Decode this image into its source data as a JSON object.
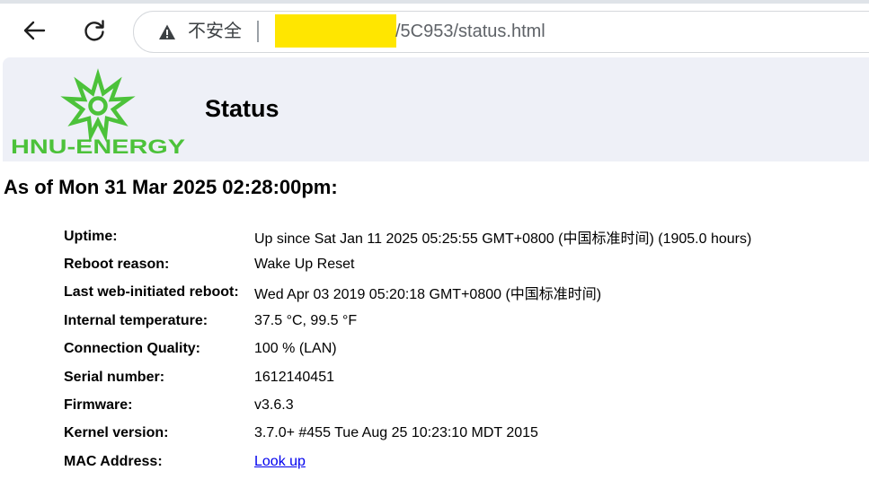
{
  "browser": {
    "security_label": "不安全",
    "url_path": "/5C953/status.html"
  },
  "banner": {
    "logo_text": "HNU-ENERGY",
    "title": "Status"
  },
  "as_of": "As of Mon 31 Mar 2025 02:28:00pm:",
  "status_rows": [
    {
      "label": "Uptime:",
      "value": "Up since Sat Jan 11 2025 05:25:55 GMT+0800 (中国标准时间) (1905.0 hours)"
    },
    {
      "label": "Reboot reason:",
      "value": "Wake Up Reset"
    },
    {
      "label": "Last web-initiated reboot:",
      "value": "Wed Apr 03 2019 05:20:18 GMT+0800 (中国标准时间)"
    },
    {
      "label": "Internal temperature:",
      "value": "37.5 °C, 99.5 °F"
    },
    {
      "label": "Connection Quality:",
      "value": "100 % (LAN)"
    },
    {
      "label": "Serial number:",
      "value": "1612140451"
    },
    {
      "label": "Firmware:",
      "value": "v3.6.3"
    },
    {
      "label": "Kernel version:",
      "value": "3.7.0+ #455 Tue Aug 25 10:23:10 MDT 2015"
    },
    {
      "label": "MAC Address:",
      "value": "Look up"
    }
  ],
  "colors": {
    "logo_green": "#4cc23a",
    "banner_bg": "#eef0f7",
    "link": "#0000ee",
    "redaction": "#ffe600"
  },
  "icons": [
    "back-arrow-icon",
    "reload-icon",
    "warning-icon",
    "hnu-energy-logo-icon"
  ]
}
